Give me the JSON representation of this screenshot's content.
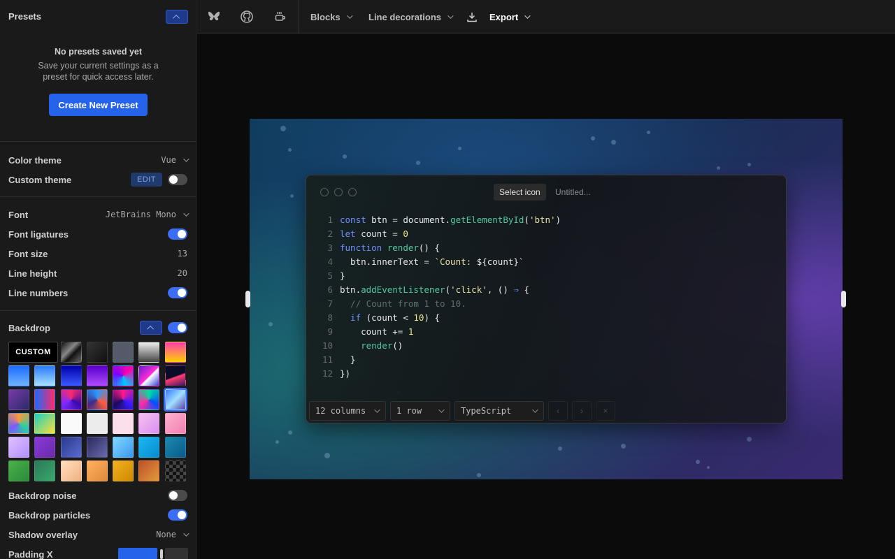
{
  "sidebar": {
    "presets": {
      "title": "Presets",
      "empty_title": "No presets saved yet",
      "empty_text_1": "Save your current settings as a",
      "empty_text_2": "preset for quick access later.",
      "create_label": "Create New Preset"
    },
    "color_theme": {
      "label": "Color theme",
      "value": "Vue"
    },
    "custom_theme": {
      "label": "Custom theme",
      "edit_label": "EDIT",
      "enabled": false
    },
    "font": {
      "label": "Font",
      "value": "JetBrains Mono"
    },
    "font_ligatures": {
      "label": "Font ligatures",
      "enabled": true
    },
    "font_size": {
      "label": "Font size",
      "value": "13"
    },
    "line_height": {
      "label": "Line height",
      "value": "20"
    },
    "line_numbers": {
      "label": "Line numbers",
      "enabled": true
    },
    "backdrop": {
      "label": "Backdrop",
      "enabled": true,
      "custom_label": "CUSTOM",
      "swatches": [
        "linear-gradient(135deg,#111,#888 40%,#111 60%,#666)",
        "linear-gradient(135deg,#333,#111)",
        "#555a6a",
        "linear-gradient(180deg,#eee,#444)",
        "linear-gradient(180deg,#ff3cac,#ffd200)",
        "linear-gradient(180deg,#1e6cff,#6fb3ff)",
        "linear-gradient(180deg,#2a7bff,#a8e0ff)",
        "linear-gradient(180deg,#0000aa,#3b5bff)",
        "linear-gradient(180deg,#5a00cc,#b04bff)",
        "conic-gradient(from 45deg,#ff00aa,#00c8ff,#7a00ff,#ff00aa)",
        "linear-gradient(135deg,#6a1bd8,#ff2bd6 50%,#fff 55%,#3040d0)",
        "linear-gradient(160deg,#0b0b2a 50%,#ff3d6e 55%,#3a1560)",
        "linear-gradient(135deg,#7a3aa8,#2a2a6a)",
        "linear-gradient(90deg,#1a6bff,#ff2a6a)",
        "conic-gradient(#ff2a6a,#3a0aaa,#7a2aff,#ff2a6a)",
        "conic-gradient(#2a9aff,#ff5a3a,#3a2a8a,#2a9aff)",
        "conic-gradient(#ff1a8a,#3a1aff,#1a0a5a,#ff1a8a)",
        "conic-gradient(#00e0a0,#0050ff,#ff2aa0,#00e0a0)",
        "linear-gradient(135deg,#3a7aff,#a0e0ff 50%,#5a3aaa)",
        "conic-gradient(#ff9a3a,#2ad0a0,#7a5aff,#ff9a3a)",
        "linear-gradient(135deg,#1ad0c0,#ffe03a)",
        "#fafafa",
        "#ececec",
        "#fbe0ec",
        "linear-gradient(135deg,#f7c0f0,#d890f0)",
        "linear-gradient(135deg,#ffb0d0,#f080b0)",
        "linear-gradient(135deg,#e0c0ff,#b090ff)",
        "linear-gradient(135deg,#8a3ad8,#6a2aaa)",
        "linear-gradient(135deg,#2a3a8a,#5a6ad0)",
        "linear-gradient(135deg,#2a2a5a,#6a6ab0)",
        "linear-gradient(135deg,#80d8ff,#3a9aee)",
        "linear-gradient(135deg,#1ab8f0,#0a8ad0)",
        "linear-gradient(135deg,#1a8ab0,#0a5a8a)",
        "linear-gradient(135deg,#4ab04a,#2a8a3a)",
        "linear-gradient(135deg,#2a7a5a,#3aa86a)",
        "linear-gradient(135deg,#ffe0c0,#f0b080)",
        "linear-gradient(135deg,#ffb060,#e08a3a)",
        "linear-gradient(135deg,#f0b020,#d08a00)",
        "linear-gradient(135deg,#c0502a,#e09a3a)",
        "repeating-conic-gradient(#111 0 25%,#444 0 50%) 0 0/10px 10px"
      ]
    },
    "backdrop_noise": {
      "label": "Backdrop noise",
      "enabled": false
    },
    "backdrop_particles": {
      "label": "Backdrop particles",
      "enabled": true
    },
    "shadow_overlay": {
      "label": "Shadow overlay",
      "value": "None"
    },
    "padding_x": {
      "label": "Padding X"
    }
  },
  "topbar": {
    "icons": [
      "butterfly-icon",
      "github-icon",
      "coffee-icon"
    ],
    "blocks_label": "Blocks",
    "line_decorations_label": "Line decorations",
    "export_label": "Export"
  },
  "editor": {
    "select_icon_label": "Select icon",
    "title_placeholder": "Untitled...",
    "columns_label": "12 columns",
    "rows_label": "1 row",
    "language_label": "TypeScript",
    "code_lines": [
      [
        [
          "kw",
          "const"
        ],
        [
          "tx",
          " btn = document."
        ],
        [
          "fn",
          "getElementById"
        ],
        [
          "tx",
          "("
        ],
        [
          "st",
          "'btn'"
        ],
        [
          "tx",
          ")"
        ]
      ],
      [
        [
          "kw",
          "let"
        ],
        [
          "tx",
          " count = "
        ],
        [
          "nm",
          "0"
        ]
      ],
      [
        [
          "kw",
          "function"
        ],
        [
          "tx",
          " "
        ],
        [
          "fn",
          "render"
        ],
        [
          "tx",
          "() {"
        ]
      ],
      [
        [
          "tx",
          "  btn.innerText = "
        ],
        [
          "st",
          "`Count: "
        ],
        [
          "tx",
          "${count}"
        ],
        [
          "st",
          "`"
        ]
      ],
      [
        [
          "tx",
          "}"
        ]
      ],
      [
        [
          "tx",
          "btn."
        ],
        [
          "fn",
          "addEventListener"
        ],
        [
          "tx",
          "("
        ],
        [
          "st",
          "'click'"
        ],
        [
          "tx",
          ", () "
        ],
        [
          "kw",
          "⇒"
        ],
        [
          "tx",
          " {"
        ]
      ],
      [
        [
          "cm",
          "  // Count from 1 to 10."
        ]
      ],
      [
        [
          "kw",
          "  if"
        ],
        [
          "tx",
          " (count < "
        ],
        [
          "nm",
          "10"
        ],
        [
          "tx",
          ") {"
        ]
      ],
      [
        [
          "tx",
          "    count += "
        ],
        [
          "nm",
          "1"
        ]
      ],
      [
        [
          "fn",
          "    render"
        ],
        [
          "tx",
          "()"
        ]
      ],
      [
        [
          "tx",
          "  }"
        ]
      ],
      [
        [
          "tx",
          "})"
        ]
      ]
    ]
  }
}
